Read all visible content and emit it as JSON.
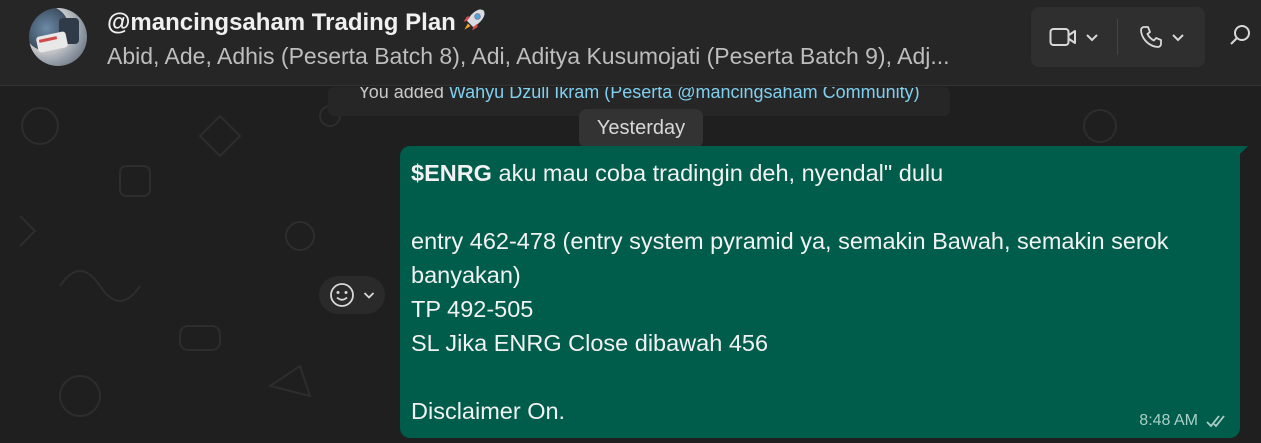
{
  "header": {
    "title": "@mancingsaham Trading Plan",
    "subtitle": "Abid, Ade, Adhis (Peserta Batch 8), Adi, Aditya Kusumojati (Peserta Batch 9), Adj...",
    "icons": {
      "video": "video-camera-icon",
      "phone": "phone-icon",
      "search": "search-icon",
      "rocket": "rocket-emoji"
    }
  },
  "system_message": {
    "prefix": "You added ",
    "link": "Wahyu Dzull Ikram (Peserta @mancingsaham Community)"
  },
  "date_divider": "Yesterday",
  "message": {
    "ticker": "$ENRG",
    "line1_rest": " aku mau coba tradingin deh, nyendal\" dulu",
    "line2": "entry 462-478 (entry system pyramid ya, semakin Bawah, semakin serok",
    "line3": "banyakan)",
    "line4": "TP 492-505",
    "line5": "SL Jika ENRG Close dibawah 456",
    "line6": "Disclaimer On.",
    "time": "8:48 AM",
    "status": "read"
  },
  "colors": {
    "bubble": "#005c4b",
    "header": "#262626",
    "link": "#7fd0f0",
    "read_ticks": "#a9cfc6"
  }
}
